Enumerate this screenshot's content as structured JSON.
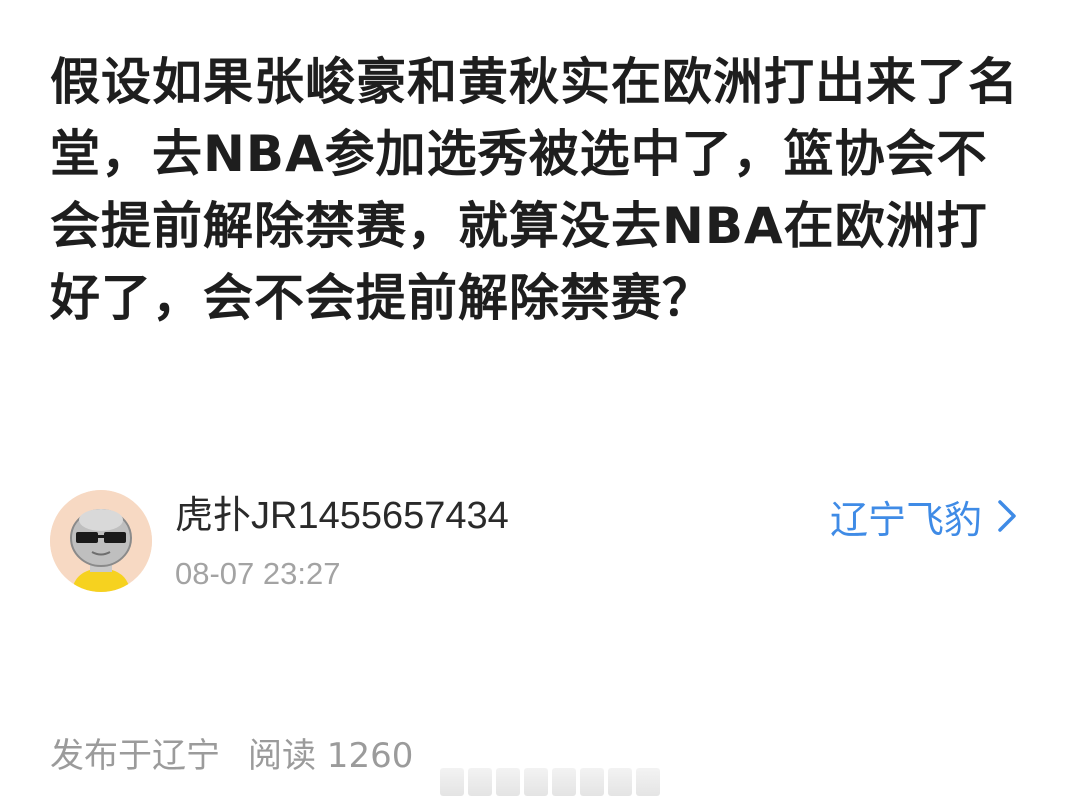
{
  "post": {
    "title": "假设如果张峻豪和黄秋实在欧洲打出来了名堂，去NBA参加选秀被选中了，篮协会不会提前解除禁赛，就算没去NBA在欧洲打好了，会不会提前解除禁赛？"
  },
  "author": {
    "name": "虎扑JR1455657434",
    "time": "08-07 23:27",
    "avatar_icon": "cartoon-avatar-with-sunglasses",
    "team_label": "辽宁飞豹",
    "team_icon": "chevron-right-icon",
    "team_color": "#3f8be6"
  },
  "meta": {
    "location": "发布于辽宁",
    "reads": "阅读 1260"
  }
}
